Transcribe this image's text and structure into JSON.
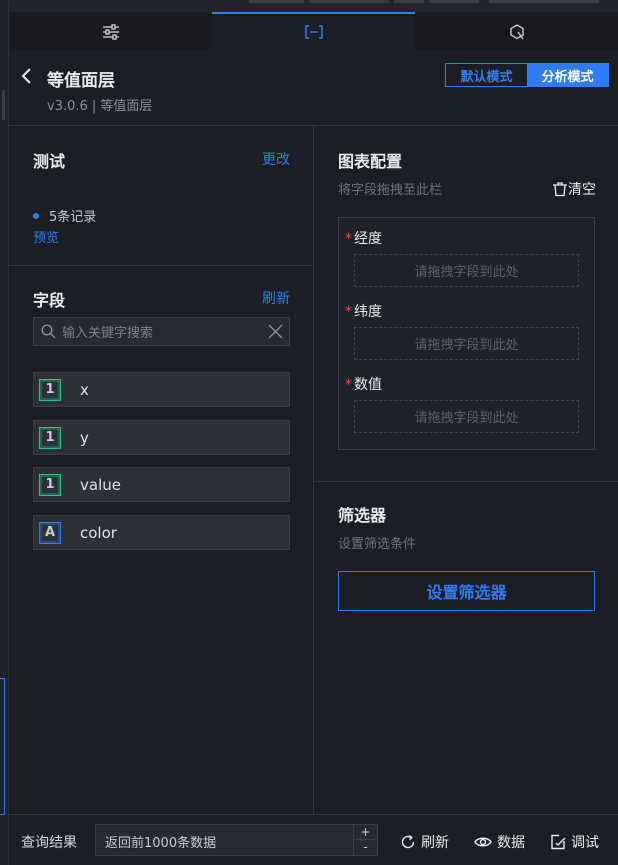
{
  "header": {
    "title": "等值面层",
    "version": "v3.0.6 | 等值面层",
    "modes": [
      "默认模式",
      "分析模式"
    ],
    "active_mode": "分析模式"
  },
  "data_panel": {
    "test_title": "测试",
    "change_link": "更改",
    "records": "5条记录",
    "preview_link": "预览",
    "fields_title": "字段",
    "refresh_link": "刷新",
    "search_placeholder": "输入关键字搜索",
    "fields": [
      {
        "name": "x",
        "type": "number",
        "type_glyph": "1"
      },
      {
        "name": "y",
        "type": "number",
        "type_glyph": "1"
      },
      {
        "name": "value",
        "type": "number",
        "type_glyph": "1"
      },
      {
        "name": "color",
        "type": "string",
        "type_glyph": "A"
      }
    ]
  },
  "chart_config": {
    "title": "图表配置",
    "hint": "将字段拖拽至此栏",
    "clear_label": "清空",
    "slots": [
      {
        "label": "经度",
        "required": true,
        "placeholder": "请拖拽字段到此处"
      },
      {
        "label": "纬度",
        "required": true,
        "placeholder": "请拖拽字段到此处"
      },
      {
        "label": "数值",
        "required": true,
        "placeholder": "请拖拽字段到此处"
      }
    ]
  },
  "filter": {
    "title": "筛选器",
    "hint": "设置筛选条件",
    "button": "设置筛选器"
  },
  "bottom_bar": {
    "label": "查询结果",
    "query_value": "返回前1000条数据",
    "refresh": "刷新",
    "data": "数据",
    "debug": "调试"
  },
  "colors": {
    "accent": "#2f7df6",
    "required_star": "#f04a4a",
    "number_type": "#2fbf80",
    "string_type": "#3f79d9"
  }
}
